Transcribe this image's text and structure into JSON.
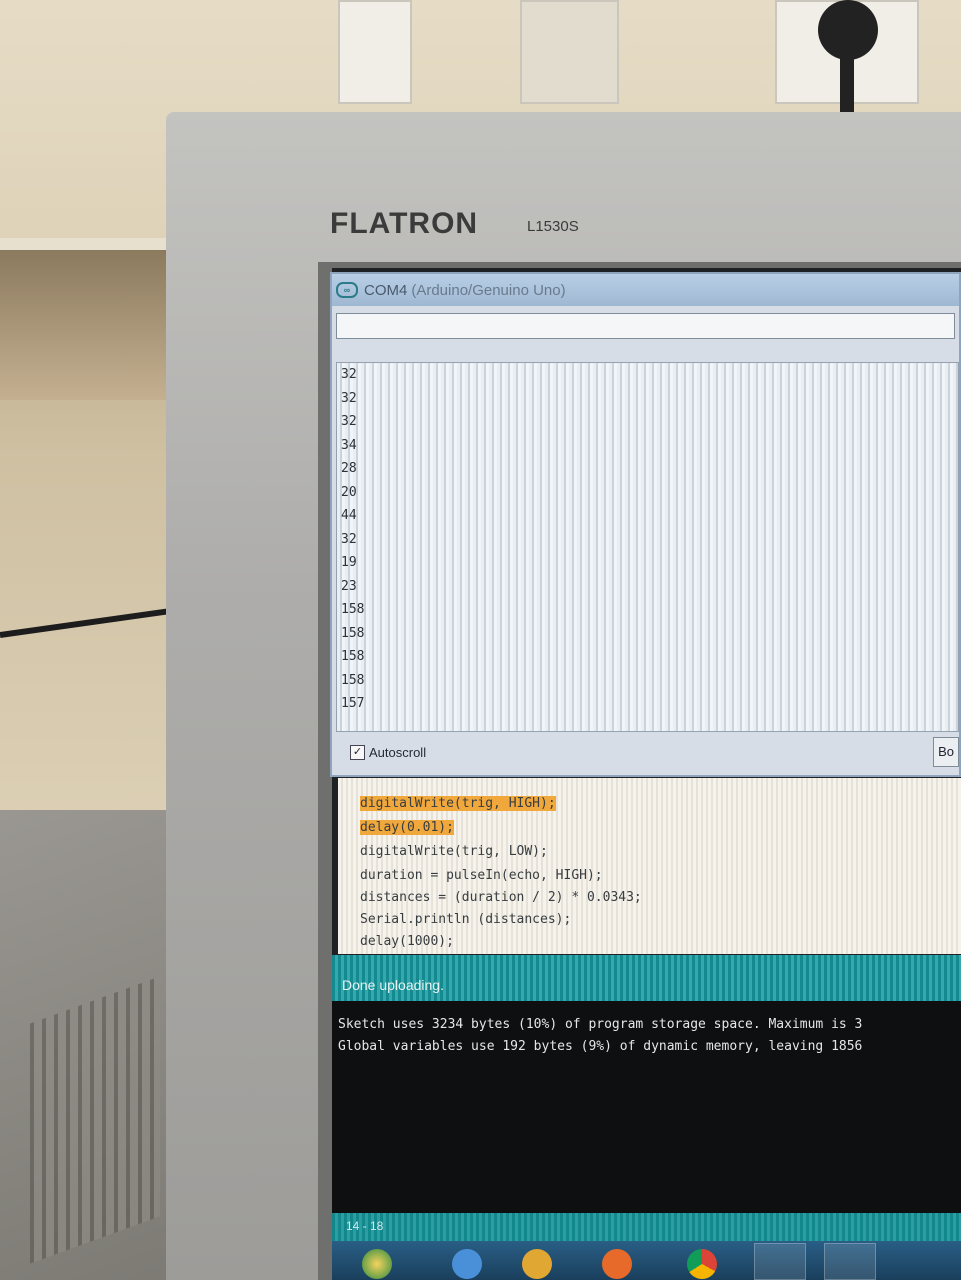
{
  "monitor": {
    "brand": "FLATRON",
    "model": "L1530S"
  },
  "serial_monitor": {
    "title": "COM4",
    "title_board": "(Arduino/Genuino Uno)",
    "send_input_value": "",
    "output_lines": [
      "32",
      "32",
      "32",
      "34",
      "28",
      "20",
      "44",
      "32",
      "19",
      "23",
      "158",
      "158",
      "158",
      "158",
      "157"
    ],
    "autoscroll_label": "Autoscroll",
    "autoscroll_checked": true,
    "baud_label": "Bo"
  },
  "code": {
    "lines": [
      "digitalWrite(trig, HIGH);",
      "delay(0.01);",
      "digitalWrite(trig, LOW);",
      "duration = pulseIn(echo, HIGH);",
      "distances = (duration / 2) * 0.0343;",
      "Serial.println (distances);",
      "delay(1000);"
    ]
  },
  "status_bar": {
    "text": "Done uploading."
  },
  "console": {
    "lines": [
      "Sketch uses 3234 bytes (10%) of program storage space. Maximum is 3",
      "Global variables use 192 bytes (9%) of dynamic memory, leaving 1856"
    ]
  },
  "footer": {
    "line_info": "14 - 18"
  },
  "colors": {
    "ide_teal": "#128a8f",
    "highlight": "#f0a83c",
    "keyword_orange": "#d35400",
    "constant_blue": "#2e87b8"
  }
}
